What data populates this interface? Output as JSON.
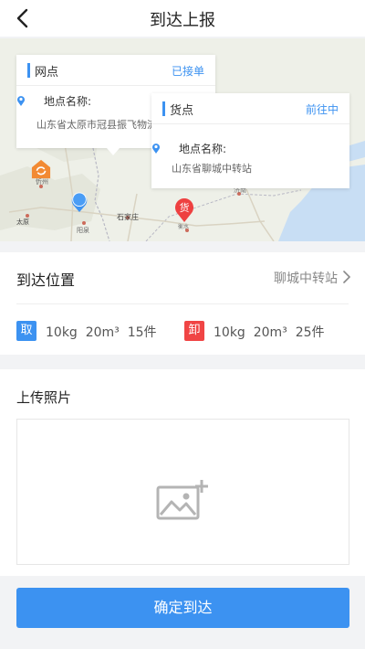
{
  "header": {
    "title": "到达上报"
  },
  "map": {
    "city_labels": [
      "忻州",
      "太原",
      "阳泉",
      "石家庄",
      "衡水",
      "济南"
    ],
    "cards": [
      {
        "title": "网点",
        "status": "已接单",
        "address_label": "地点名称:",
        "address": "山东省太原市冠县振飞物流"
      },
      {
        "title": "货点",
        "status": "前往中",
        "address_label": "地点名称:",
        "address": "山东省聊城中转站"
      }
    ],
    "goods_marker": "货"
  },
  "arrival": {
    "label": "到达位置",
    "value": "聊城中转站",
    "pickup": {
      "badge": "取",
      "weight": "10kg",
      "volume": "20m³",
      "count": "15件"
    },
    "dropoff": {
      "badge": "卸",
      "weight": "10kg",
      "volume": "20m³",
      "count": "25件"
    }
  },
  "upload": {
    "title": "上传照片"
  },
  "confirm_button": "确定到达",
  "colors": {
    "accent": "#3c92f1",
    "danger": "#f04545",
    "pickup": "#3c92f1",
    "dropoff": "#f04545"
  }
}
